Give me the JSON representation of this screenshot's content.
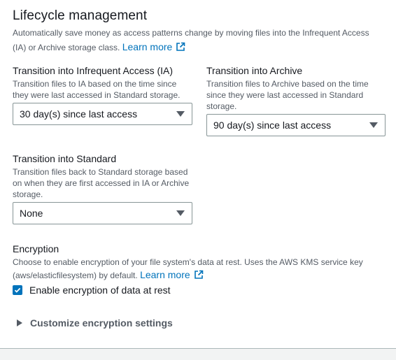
{
  "lifecycle": {
    "title": "Lifecycle management",
    "description": "Automatically save money as access patterns change by moving files into the Infrequent Access (IA) or Archive storage class.",
    "learn_more": "Learn more"
  },
  "transition_ia": {
    "label": "Transition into Infrequent Access (IA)",
    "description": "Transition files to IA based on the time since they were last accessed in Standard storage.",
    "selected": "30 day(s) since last access"
  },
  "transition_archive": {
    "label": "Transition into Archive",
    "description": "Transition files to Archive based on the time since they were last accessed in Standard storage.",
    "selected": "90 day(s) since last access"
  },
  "transition_standard": {
    "label": "Transition into Standard",
    "description": "Transition files back to Standard storage based on when they are first accessed in IA or Archive storage.",
    "selected": "None"
  },
  "encryption": {
    "title": "Encryption",
    "description": "Choose to enable encryption of your file system's data at rest. Uses the AWS KMS service key (aws/elasticfilesystem) by default.",
    "learn_more": "Learn more",
    "checkbox_label": "Enable encryption of data at rest",
    "checked": true,
    "expander_label": "Customize encryption settings"
  },
  "colors": {
    "link": "#0073bb",
    "checkbox": "#0073bb",
    "border": "#879596",
    "muted_text": "#545b64"
  }
}
